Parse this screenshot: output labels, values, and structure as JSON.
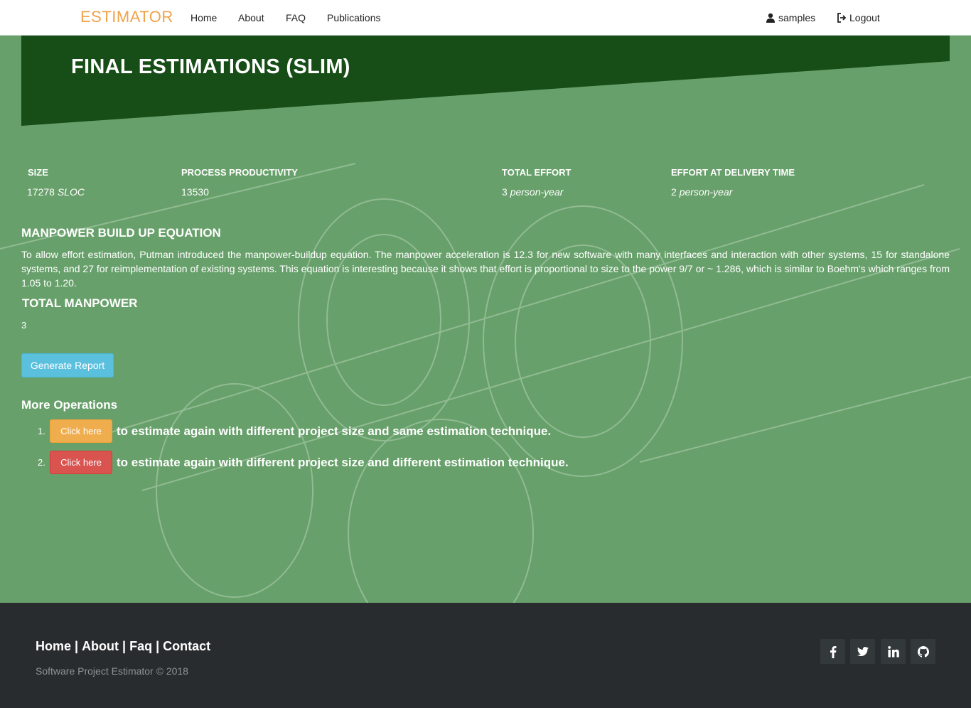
{
  "nav": {
    "brand": "ESTIMATOR",
    "links": [
      "Home",
      "About",
      "FAQ",
      "Publications"
    ],
    "user": "samples",
    "logout": "Logout"
  },
  "page": {
    "title": "FINAL ESTIMATIONS (SLIM)"
  },
  "stats": [
    {
      "label": "SIZE",
      "value": "17278",
      "unit": "SLOC"
    },
    {
      "label": "PROCESS PRODUCTIVITY",
      "value": "13530",
      "unit": ""
    },
    {
      "label": "TOTAL EFFORT",
      "value": "3",
      "unit": "person-year"
    },
    {
      "label": "EFFORT AT DELIVERY TIME",
      "value": "2",
      "unit": "person-year"
    }
  ],
  "equation": {
    "heading": "MANPOWER BUILD UP EQUATION",
    "text": "To allow effort estimation, Putman introduced the manpower-buildup equation. The manpower acceleration is 12.3 for new software with many interfaces and interaction with other systems, 15 for standalone systems, and 27 for reimplementation of existing systems. This equation is interesting because it shows that effort is proportional to size to the power 9/7 or ~ 1.286, which is similar to Boehm's which ranges from 1.05 to 1.20."
  },
  "manpower": {
    "heading": "TOTAL MANPOWER",
    "value": "3"
  },
  "report_button": "Generate Report",
  "more": {
    "heading": "More Operations",
    "items": [
      {
        "num": "1.",
        "button": "Click here",
        "text": "to estimate again with different project size and same estimation technique."
      },
      {
        "num": "2.",
        "button": "Click here",
        "text": "to estimate again with different project size and different estimation technique."
      }
    ]
  },
  "footer": {
    "links": [
      "Home",
      "About",
      "Faq",
      "Contact"
    ],
    "copyright": "Software Project Estimator © 2018",
    "social": [
      "facebook-icon",
      "twitter-icon",
      "linkedin-icon",
      "github-icon"
    ]
  },
  "colors": {
    "brand": "#f0a34a",
    "banner": "#174d17",
    "background": "#67a06a",
    "footer": "#292c2f",
    "info": "#5bc0de",
    "warning": "#f0ad4e",
    "danger": "#d9534f"
  }
}
